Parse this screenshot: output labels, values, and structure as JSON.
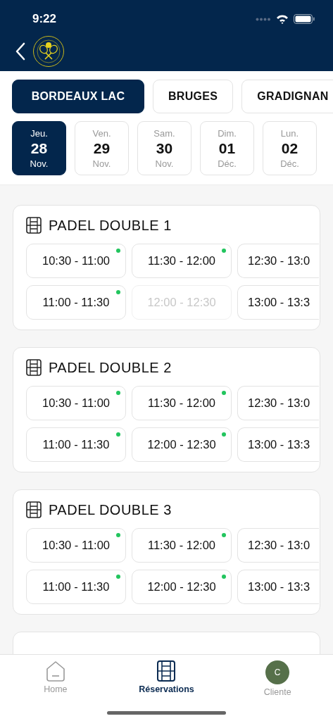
{
  "status_bar": {
    "time": "9:22"
  },
  "clubs": [
    {
      "label": "BORDEAUX LAC",
      "selected": true
    },
    {
      "label": "BRUGES",
      "selected": false
    },
    {
      "label": "GRADIGNAN",
      "selected": false
    }
  ],
  "dates": [
    {
      "weekday": "Jeu.",
      "day": "28",
      "month": "Nov.",
      "selected": true
    },
    {
      "weekday": "Ven.",
      "day": "29",
      "month": "Nov.",
      "selected": false
    },
    {
      "weekday": "Sam.",
      "day": "30",
      "month": "Nov.",
      "selected": false
    },
    {
      "weekday": "Dim.",
      "day": "01",
      "month": "Déc.",
      "selected": false
    },
    {
      "weekday": "Lun.",
      "day": "02",
      "month": "Déc.",
      "selected": false
    }
  ],
  "courts": [
    {
      "title": "PADEL DOUBLE 1",
      "slots": [
        {
          "time": "10:30 - 11:00",
          "available": true,
          "disabled": false
        },
        {
          "time": "11:30 - 12:00",
          "available": true,
          "disabled": false
        },
        {
          "time": "12:30 - 13:0",
          "available": false,
          "disabled": false
        },
        {
          "time": "11:00 - 11:30",
          "available": true,
          "disabled": false
        },
        {
          "time": "12:00 - 12:30",
          "available": false,
          "disabled": true
        },
        {
          "time": "13:00 - 13:3",
          "available": false,
          "disabled": false
        }
      ]
    },
    {
      "title": "PADEL DOUBLE 2",
      "slots": [
        {
          "time": "10:30 - 11:00",
          "available": true,
          "disabled": false
        },
        {
          "time": "11:30 - 12:00",
          "available": true,
          "disabled": false
        },
        {
          "time": "12:30 - 13:0",
          "available": false,
          "disabled": false
        },
        {
          "time": "11:00 - 11:30",
          "available": true,
          "disabled": false
        },
        {
          "time": "12:00 - 12:30",
          "available": true,
          "disabled": false
        },
        {
          "time": "13:00 - 13:3",
          "available": false,
          "disabled": false
        }
      ]
    },
    {
      "title": "PADEL DOUBLE 3",
      "slots": [
        {
          "time": "10:30 - 11:00",
          "available": true,
          "disabled": false
        },
        {
          "time": "11:30 - 12:00",
          "available": true,
          "disabled": false
        },
        {
          "time": "12:30 - 13:0",
          "available": false,
          "disabled": false
        },
        {
          "time": "11:00 - 11:30",
          "available": true,
          "disabled": false
        },
        {
          "time": "12:00 - 12:30",
          "available": true,
          "disabled": false
        },
        {
          "time": "13:00 - 13:3",
          "available": false,
          "disabled": false
        }
      ]
    }
  ],
  "tab_bar": [
    {
      "label": "Home",
      "kind": "home",
      "selected": false
    },
    {
      "label": "Réservations",
      "kind": "reservations",
      "selected": true
    },
    {
      "label": "Cliente",
      "kind": "avatar",
      "initial": "C",
      "selected": false
    }
  ]
}
